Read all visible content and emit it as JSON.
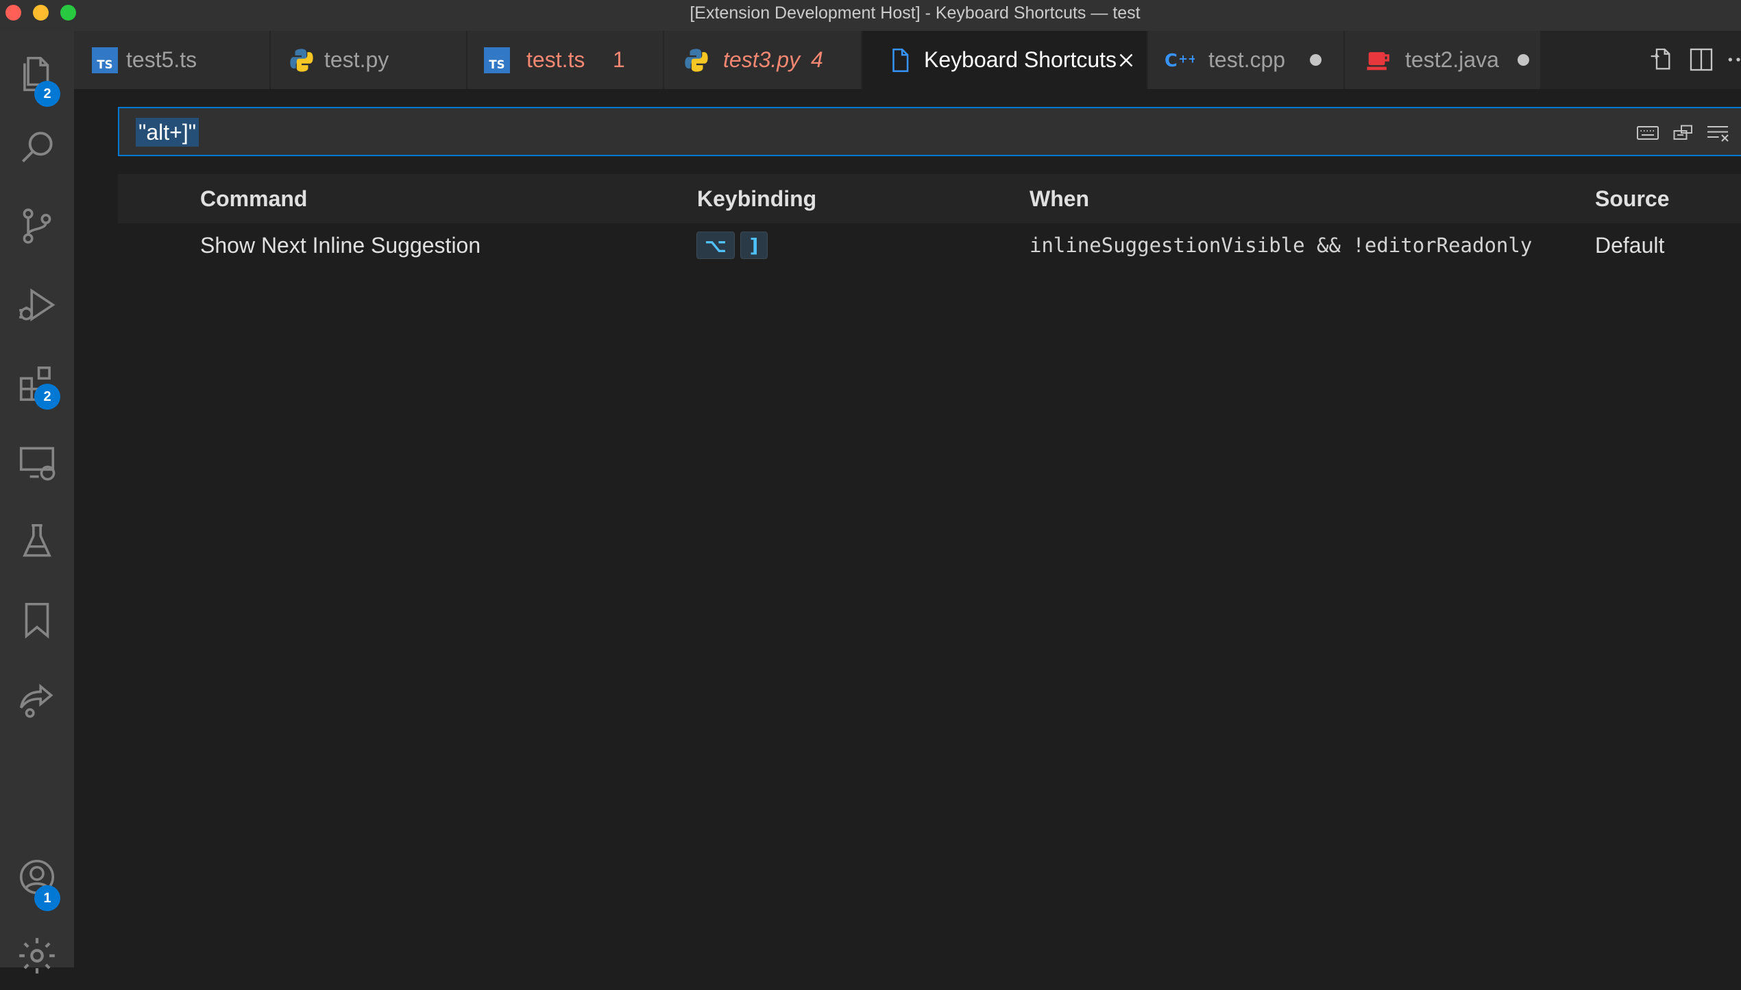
{
  "window": {
    "title": "[Extension Development Host] - Keyboard Shortcuts — test"
  },
  "activity_bar": {
    "items": [
      {
        "name": "explorer",
        "badge": "2"
      },
      {
        "name": "search"
      },
      {
        "name": "source-control"
      },
      {
        "name": "run-and-debug"
      },
      {
        "name": "extensions",
        "badge": "2"
      },
      {
        "name": "remote-explorer"
      },
      {
        "name": "testing"
      },
      {
        "name": "bookmarks"
      },
      {
        "name": "live-share"
      },
      {
        "name": "accounts",
        "badge": "1"
      },
      {
        "name": "manage"
      }
    ]
  },
  "tabs": [
    {
      "label": "test5.ts",
      "icon": "typescript-icon"
    },
    {
      "label": "test.py",
      "icon": "python-icon"
    },
    {
      "label": "test.ts",
      "icon": "typescript-icon",
      "count": "1",
      "error": true
    },
    {
      "label": "test3.py",
      "icon": "python-icon",
      "count": "4",
      "error": true,
      "italic": true
    },
    {
      "label": "Keyboard Shortcuts",
      "icon": "file-icon",
      "active": true
    },
    {
      "label": "test.cpp",
      "icon": "cpp-icon",
      "modified": true
    },
    {
      "label": "test2.java",
      "icon": "java-icon",
      "modified": true
    }
  ],
  "search": {
    "value": "\"alt+]\""
  },
  "table": {
    "headers": {
      "command": "Command",
      "keybinding": "Keybinding",
      "when": "When",
      "source": "Source"
    },
    "rows": [
      {
        "command": "Show Next Inline Suggestion",
        "keys": [
          "⌥",
          "]"
        ],
        "when": "inlineSuggestionVisible && !editorReadonly",
        "source": "Default"
      }
    ]
  },
  "colors": {
    "accent": "#0078d4",
    "error": "#f48771",
    "key": "#4fc1ff",
    "background": "#1e1e1e"
  }
}
